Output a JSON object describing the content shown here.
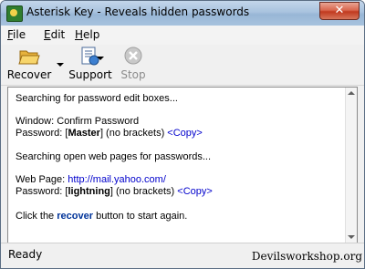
{
  "window": {
    "title": "Asterisk Key - Reveals hidden passwords",
    "close_label": "✕"
  },
  "menu": {
    "items": [
      "File",
      "Edit",
      "Help"
    ]
  },
  "toolbar": {
    "recover_label": "Recover",
    "support_label": "Support",
    "stop_label": "Stop"
  },
  "output": {
    "line1": "Searching for password edit boxes...",
    "window_prefix": "Window: ",
    "window_name": "Confirm Password",
    "password_prefix": "Password: [",
    "password1": "Master",
    "password1_suffix": "] (no brackets) ",
    "copy1": "<Copy>",
    "line_search_web": "Searching open web pages for passwords...",
    "webpage_prefix": "Web Page: ",
    "webpage_url": "http://mail.yahoo.com/",
    "password2_prefix": "Password: [",
    "password2": "lightning",
    "password2_suffix": "] (no brackets) ",
    "copy2": "<Copy>",
    "click_prefix": "Click the ",
    "click_word": "recover",
    "click_suffix": " button to start again."
  },
  "status": {
    "text": "Ready"
  },
  "watermark": "Devilsworkshop.org"
}
